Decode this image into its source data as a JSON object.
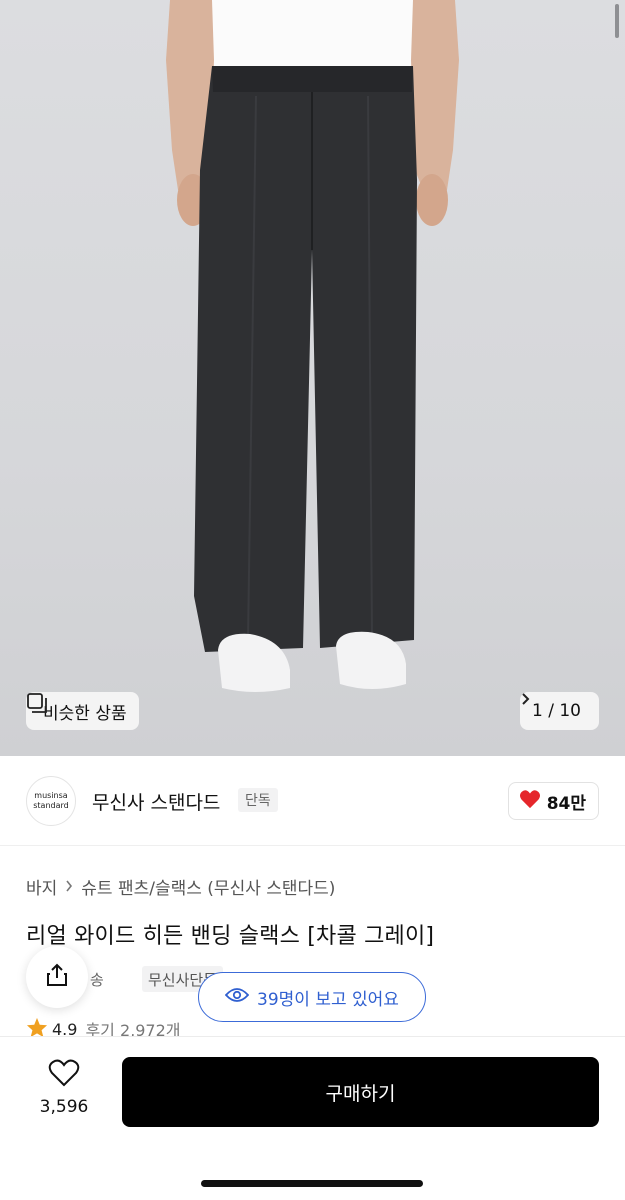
{
  "gallery": {
    "similar_label": "비슷한 상품",
    "similar_icon": "similar-items-icon",
    "counter": "1 / 10",
    "counter_icon": "chevron-right-icon"
  },
  "brand": {
    "logo_line1": "musinsa",
    "logo_line2": "standard",
    "name": "무신사 스탠다드",
    "badge": "단독",
    "likes": "84만",
    "like_icon": "heart-filled-icon",
    "like_color": "#e5262b"
  },
  "product": {
    "breadcrumb": [
      "바지",
      "슈트 팬츠/슬랙스 (무신사 스탠다드)"
    ],
    "title": "리얼 와이드 히든 밴딩 슬랙스 [차콜 그레이]",
    "shipping_fragment": "송",
    "exclusive_badge": "무신사단독",
    "viewers": "39명이 보고 있어요",
    "viewers_color": "#2f5fd0",
    "rating": "4.9",
    "reviews": "후기 2,972개",
    "star_color": "#f0a020"
  },
  "actions": {
    "share_icon": "share-icon",
    "wish_icon": "heart-outline-icon",
    "wish_count": "3,596",
    "buy_label": "구매하기"
  }
}
